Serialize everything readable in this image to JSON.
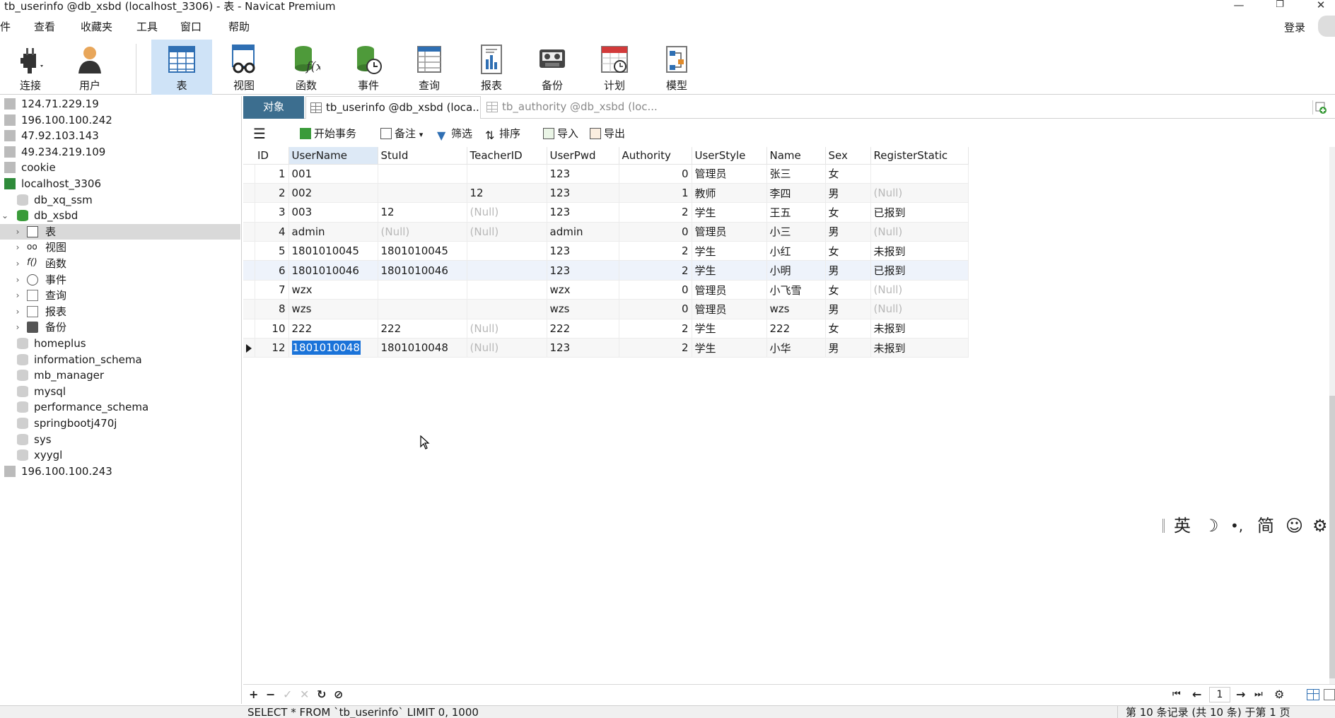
{
  "window": {
    "title": "tb_userinfo @db_xsbd (localhost_3306) - 表 - Navicat Premium",
    "minimize": "—",
    "restore": "❐",
    "close": "✕"
  },
  "menu": [
    "文件",
    "查看",
    "收藏夹",
    "工具",
    "窗口",
    "帮助"
  ],
  "menu_visible_first": "件",
  "login_label": "登录",
  "toolbar": {
    "connect": "连接",
    "user": "用户",
    "table": "表",
    "view": "视图",
    "function": "函数",
    "event": "事件",
    "query": "查询",
    "report": "报表",
    "backup": "备份",
    "schedule": "计划",
    "model": "模型",
    "active": "表"
  },
  "tree": {
    "connections_top": [
      "124.71.229.19",
      "196.100.100.242",
      "47.92.103.143",
      "49.234.219.109",
      "cookie"
    ],
    "local_connection": "localhost_3306",
    "databases_before": [
      "db_xq_ssm"
    ],
    "open_database": "db_xsbd",
    "open_db_children": [
      "表",
      "视图",
      "函数",
      "事件",
      "查询",
      "报表",
      "备份"
    ],
    "databases_after": [
      "homeplus",
      "information_schema",
      "mb_manager",
      "mysql",
      "performance_schema",
      "springbootj470j",
      "sys",
      "xyygl"
    ],
    "connection_last": "196.100.100.243"
  },
  "tabs": {
    "objects": "对象",
    "tab1": "tb_userinfo @db_xsbd (loca...",
    "tab2": "tb_authority @db_xsbd (loc..."
  },
  "objbar": {
    "begin_tx": "开始事务",
    "memo": "备注",
    "filter": "筛选",
    "sort": "排序",
    "import": "导入",
    "export": "导出"
  },
  "grid": {
    "columns": [
      "ID",
      "UserName",
      "StuId",
      "TeacherID",
      "UserPwd",
      "Authority",
      "UserStyle",
      "Name",
      "Sex",
      "RegisterStatic"
    ],
    "rows": [
      [
        "1",
        "001",
        "",
        "",
        "123",
        "0",
        "管理员",
        "张三",
        "女",
        ""
      ],
      [
        "2",
        "002",
        "",
        "12",
        "123",
        "1",
        "教师",
        "李四",
        "男",
        "(Null)"
      ],
      [
        "3",
        "003",
        "12",
        "(Null)",
        "123",
        "2",
        "学生",
        "王五",
        "女",
        "已报到"
      ],
      [
        "4",
        "admin",
        "(Null)",
        "(Null)",
        "admin",
        "0",
        "管理员",
        "小三",
        "男",
        "(Null)"
      ],
      [
        "5",
        "1801010045",
        "1801010045",
        "",
        "123",
        "2",
        "学生",
        "小红",
        "女",
        "未报到"
      ],
      [
        "6",
        "1801010046",
        "1801010046",
        "",
        "123",
        "2",
        "学生",
        "小明",
        "男",
        "已报到"
      ],
      [
        "7",
        "wzx",
        "",
        "",
        "wzx",
        "0",
        "管理员",
        "小飞雪",
        "女",
        "(Null)"
      ],
      [
        "8",
        "wzs",
        "",
        "",
        "wzs",
        "0",
        "管理员",
        "wzs",
        "男",
        "(Null)"
      ],
      [
        "10",
        "222",
        "222",
        "(Null)",
        "222",
        "2",
        "学生",
        "222",
        "女",
        "未报到"
      ],
      [
        "12",
        "1801010048",
        "1801010048",
        "(Null)",
        "123",
        "2",
        "学生",
        "小华",
        "男",
        "未报到"
      ]
    ],
    "current_row": "12",
    "selected_cell": "1801010048"
  },
  "ime": {
    "lang": "英",
    "moon": "☽",
    "punct": "•,",
    "simp": "简",
    "emoji": "☺",
    "settings": "⚙"
  },
  "bottombar": {
    "add": "+",
    "remove": "−",
    "apply": "✓",
    "cancel": "✕",
    "refresh": "↻",
    "stop": "⊘",
    "first": "⏮",
    "prev": "←",
    "page": "1",
    "next": "→",
    "last": "⏭",
    "settings": "⚙"
  },
  "status": {
    "sql": "SELECT * FROM `tb_userinfo` LIMIT 0, 1000",
    "records": "第 10 条记录 (共 10 条) 于第 1 页"
  }
}
